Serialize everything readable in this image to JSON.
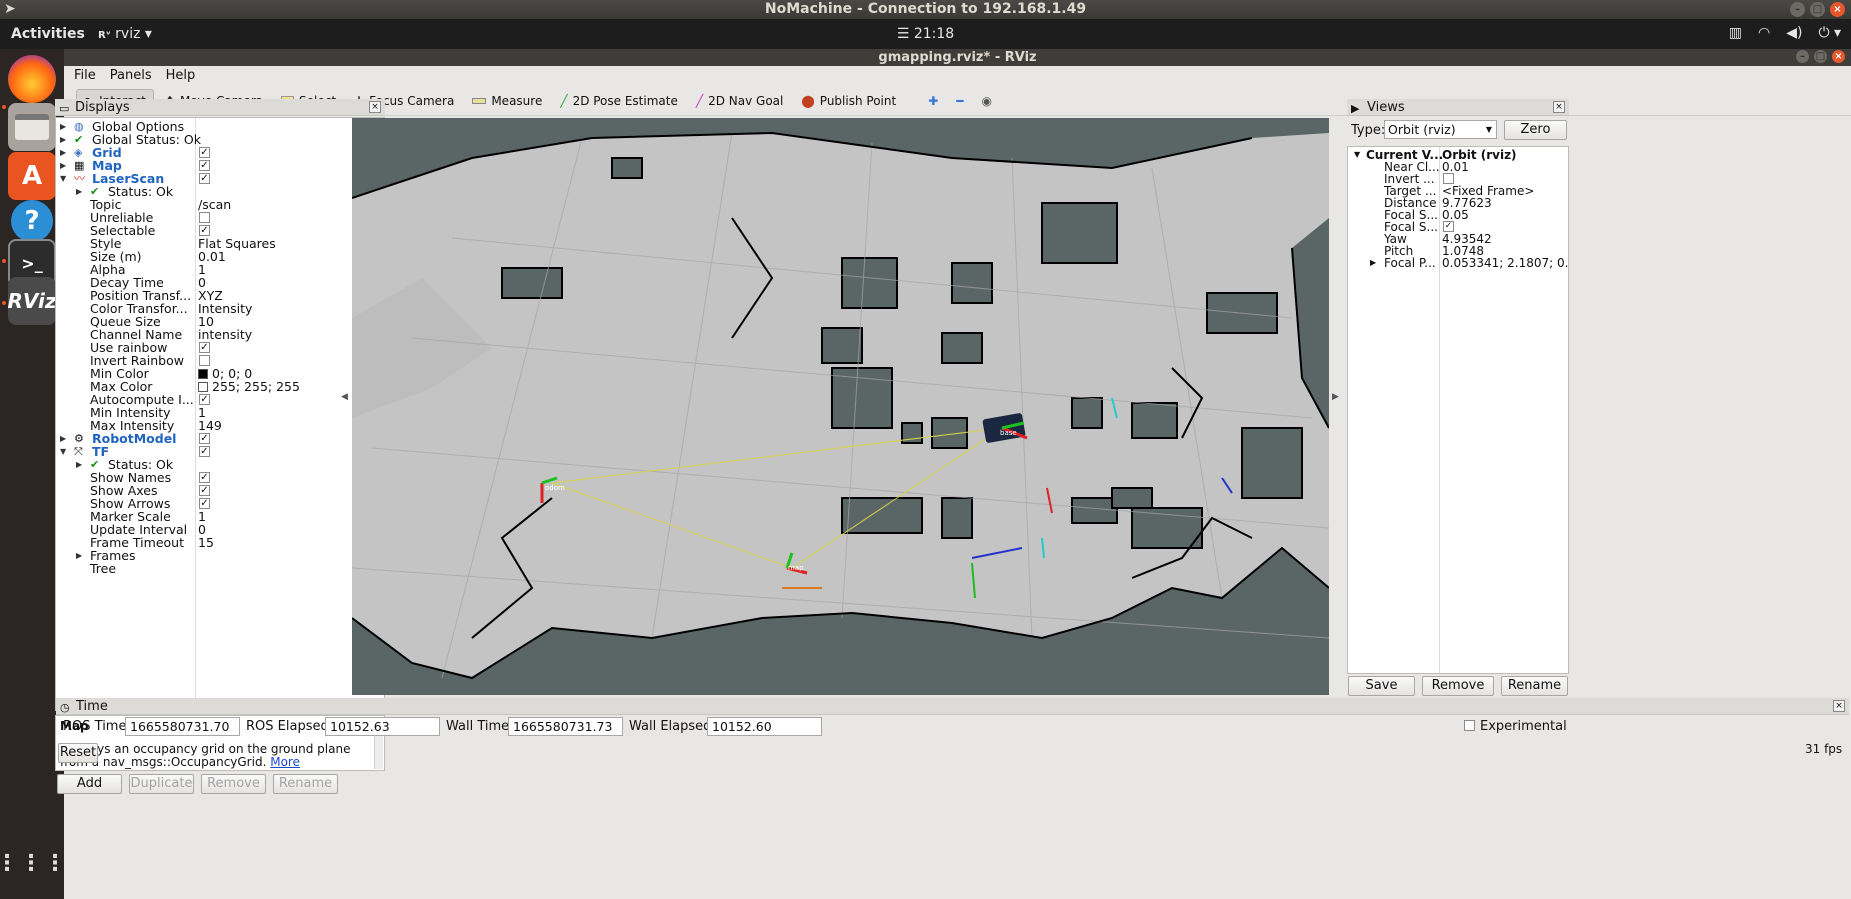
{
  "nomachine": {
    "title": "NoMachine - Connection to 192.168.1.49"
  },
  "gnome": {
    "activities": "Activities",
    "app_menu": "rviz",
    "clock": "21:18"
  },
  "window": {
    "title": "gmapping.rviz* - RViz"
  },
  "menu": [
    "File",
    "Panels",
    "Help"
  ],
  "toolbar": {
    "interact": "Interact",
    "move_camera": "Move Camera",
    "select": "Select",
    "focus_camera": "Focus Camera",
    "measure": "Measure",
    "pose_estimate": "2D Pose Estimate",
    "nav_goal": "2D Nav Goal",
    "publish_point": "Publish Point"
  },
  "displays": {
    "title": "Displays",
    "rows": [
      {
        "name": "Global Options",
        "indent": 0,
        "arrow": "right",
        "icon": "globe-icon"
      },
      {
        "name": "Global Status: Ok",
        "indent": 0,
        "arrow": "right",
        "icon": "check-icon"
      },
      {
        "name": "Grid",
        "indent": 0,
        "arrow": "right",
        "icon": "grid-icon",
        "blue": true,
        "checked": true
      },
      {
        "name": "Map",
        "indent": 0,
        "arrow": "right",
        "icon": "map-icon",
        "blue": true,
        "checked": true
      },
      {
        "name": "LaserScan",
        "indent": 0,
        "arrow": "down",
        "icon": "laser-icon",
        "blue": true,
        "checked": true
      },
      {
        "name": "Status: Ok",
        "indent": 1,
        "arrow": "right",
        "icon": "check-icon"
      },
      {
        "name": "Topic",
        "indent": 2,
        "value": "/scan"
      },
      {
        "name": "Unreliable",
        "indent": 2,
        "checked": false
      },
      {
        "name": "Selectable",
        "indent": 2,
        "checked": true
      },
      {
        "name": "Style",
        "indent": 2,
        "value": "Flat Squares"
      },
      {
        "name": "Size (m)",
        "indent": 2,
        "value": "0.01"
      },
      {
        "name": "Alpha",
        "indent": 2,
        "value": "1"
      },
      {
        "name": "Decay Time",
        "indent": 2,
        "value": "0"
      },
      {
        "name": "Position Transf...",
        "indent": 2,
        "value": "XYZ"
      },
      {
        "name": "Color Transfor...",
        "indent": 2,
        "value": "Intensity"
      },
      {
        "name": "Queue Size",
        "indent": 2,
        "value": "10"
      },
      {
        "name": "Channel Name",
        "indent": 2,
        "value": "intensity"
      },
      {
        "name": "Use rainbow",
        "indent": 2,
        "checked": true
      },
      {
        "name": "Invert Rainbow",
        "indent": 2,
        "checked": false
      },
      {
        "name": "Min Color",
        "indent": 2,
        "value": "0; 0; 0",
        "swatch": "#000000"
      },
      {
        "name": "Max Color",
        "indent": 2,
        "value": "255; 255; 255",
        "swatch": "#ffffff"
      },
      {
        "name": "Autocompute I...",
        "indent": 2,
        "checked": true
      },
      {
        "name": "Min Intensity",
        "indent": 2,
        "value": "1"
      },
      {
        "name": "Max Intensity",
        "indent": 2,
        "value": "149"
      },
      {
        "name": "RobotModel",
        "indent": 0,
        "arrow": "right",
        "icon": "robot-icon",
        "blue": true,
        "checked": true
      },
      {
        "name": "TF",
        "indent": 0,
        "arrow": "down",
        "icon": "tf-icon",
        "blue": true,
        "checked": true
      },
      {
        "name": "Status: Ok",
        "indent": 1,
        "arrow": "right",
        "icon": "check-icon"
      },
      {
        "name": "Show Names",
        "indent": 2,
        "checked": true
      },
      {
        "name": "Show Axes",
        "indent": 2,
        "checked": true
      },
      {
        "name": "Show Arrows",
        "indent": 2,
        "checked": true
      },
      {
        "name": "Marker Scale",
        "indent": 2,
        "value": "1"
      },
      {
        "name": "Update Interval",
        "indent": 2,
        "value": "0"
      },
      {
        "name": "Frame Timeout",
        "indent": 2,
        "value": "15"
      },
      {
        "name": "Frames",
        "indent": 1,
        "arrow": "right"
      },
      {
        "name": "Tree",
        "indent": 1
      }
    ],
    "description_title": "Map",
    "description": "Displays an occupancy grid on the ground plane from a nav_msgs::OccupancyGrid.",
    "more_link": "More",
    "buttons": {
      "add": "Add",
      "duplicate": "Duplicate",
      "remove": "Remove",
      "rename": "Rename"
    }
  },
  "views": {
    "title": "Views",
    "type_label": "Type:",
    "type_value": "Orbit (rviz)",
    "zero": "Zero",
    "rows": [
      {
        "name": "Current V...",
        "value": "Orbit (rviz)",
        "header": true
      },
      {
        "name": "Near Cl...",
        "value": "0.01"
      },
      {
        "name": "Invert ...",
        "checked": false
      },
      {
        "name": "Target ...",
        "value": "<Fixed Frame>"
      },
      {
        "name": "Distance",
        "value": "9.77623"
      },
      {
        "name": "Focal S...",
        "value": "0.05"
      },
      {
        "name": "Focal S...",
        "checked": true
      },
      {
        "name": "Yaw",
        "value": "4.93542"
      },
      {
        "name": "Pitch",
        "value": "1.0748"
      },
      {
        "name": "Focal P...",
        "value": "0.053341; 2.1807; 0....",
        "arrow": true
      }
    ],
    "buttons": {
      "save": "Save",
      "remove": "Remove",
      "rename": "Rename"
    }
  },
  "time": {
    "title": "Time",
    "ros_time_label": "ROS Time:",
    "ros_time": "1665580731.70",
    "ros_elapsed_label": "ROS Elapsed:",
    "ros_elapsed": "10152.63",
    "wall_time_label": "Wall Time:",
    "wall_time": "1665580731.73",
    "wall_elapsed_label": "Wall Elapsed:",
    "wall_elapsed": "10152.60",
    "experimental": "Experimental",
    "reset": "Reset",
    "fps": "31 fps"
  },
  "viewport": {
    "frame_labels": [
      "base",
      "odom",
      "map"
    ],
    "colors": {
      "background": "#5a6666",
      "free": "#c4c4c4",
      "occupied": "#000000",
      "grid": "#a5a5a5"
    }
  }
}
